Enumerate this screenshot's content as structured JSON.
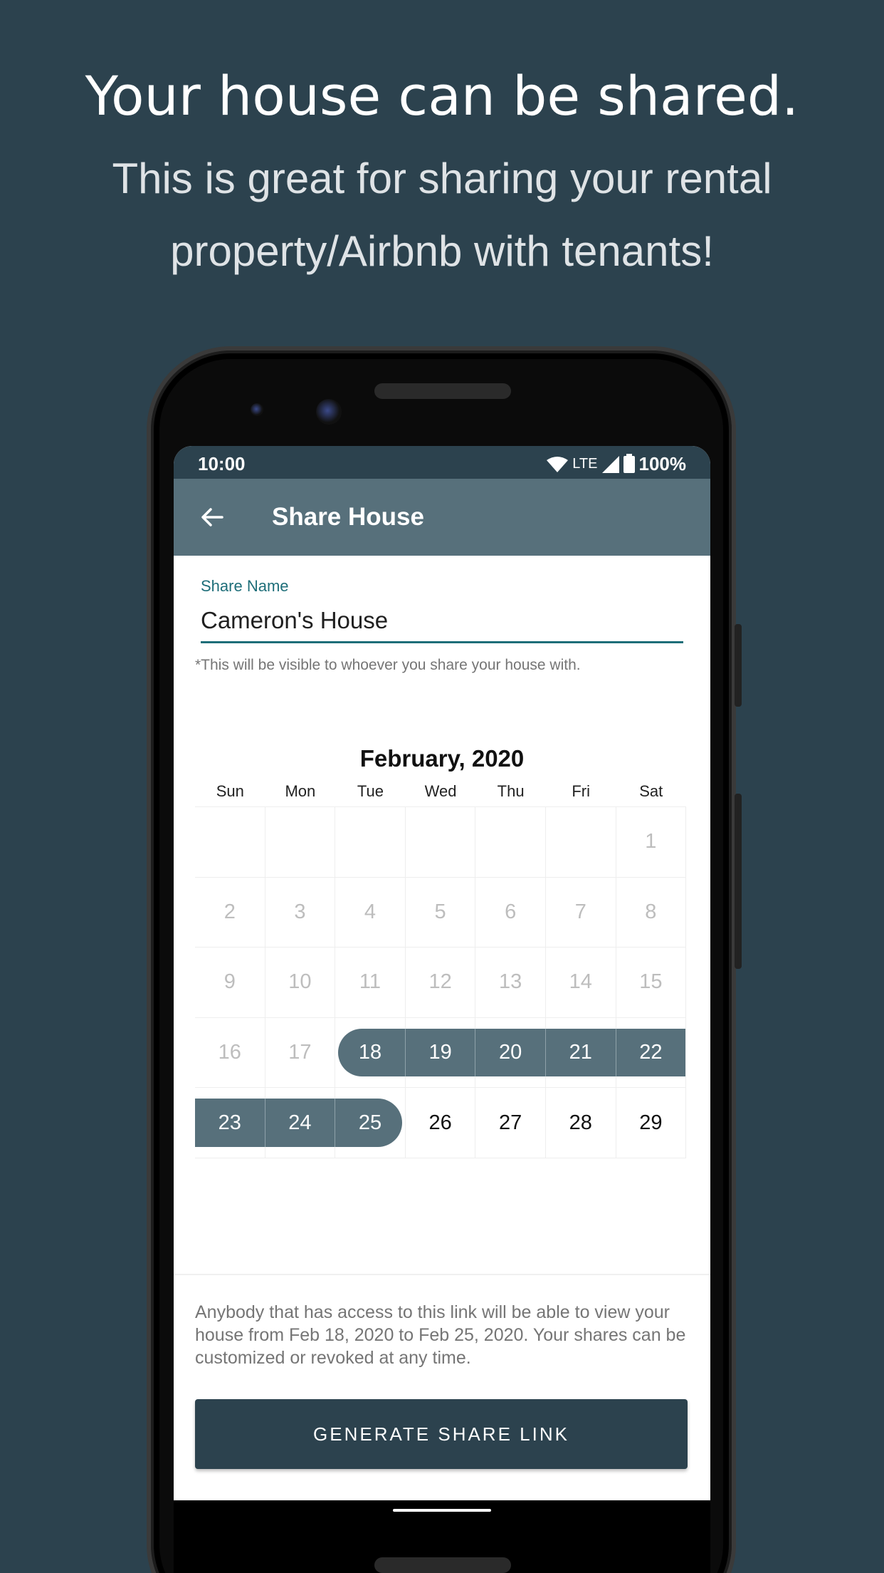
{
  "promo": {
    "headline": "Your house can be shared.",
    "subhead": "This is great for sharing your rental property/Airbnb with tenants!"
  },
  "status_bar": {
    "time": "10:00",
    "network": "LTE",
    "battery": "100%"
  },
  "app_bar": {
    "title": "Share House",
    "back_icon": "arrow-back-icon"
  },
  "share_name": {
    "label": "Share Name",
    "value": "Cameron's House",
    "helper": "*This will be visible to whoever you share your house with."
  },
  "calendar": {
    "month_label": "February, 2020",
    "weekdays": [
      "Sun",
      "Mon",
      "Tue",
      "Wed",
      "Thu",
      "Fri",
      "Sat"
    ],
    "weeks": [
      [
        "",
        "",
        "",
        "",
        "",
        "",
        "1"
      ],
      [
        "2",
        "3",
        "4",
        "5",
        "6",
        "7",
        "8"
      ],
      [
        "9",
        "10",
        "11",
        "12",
        "13",
        "14",
        "15"
      ],
      [
        "16",
        "17",
        "18",
        "19",
        "20",
        "21",
        "22"
      ],
      [
        "23",
        "24",
        "25",
        "26",
        "27",
        "28",
        "29"
      ]
    ],
    "selected_range": {
      "start": "18",
      "end": "25"
    },
    "disabled_through": "17"
  },
  "info_text": "Anybody that has access to this link will be able to view your house from Feb 18, 2020 to Feb 25, 2020. Your shares can be customized or revoked at any time.",
  "generate_button": "GENERATE SHARE LINK",
  "colors": {
    "background": "#2c424e",
    "app_bar": "#57707b",
    "accent": "#1e6e79",
    "selection": "#57707b",
    "button": "#2c424e"
  }
}
